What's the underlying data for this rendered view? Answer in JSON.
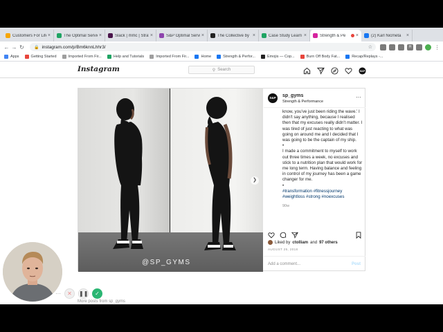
{
  "browser": {
    "tabs": [
      {
        "title": "Customers For Life",
        "color": "#f7a600",
        "active": false
      },
      {
        "title": "The Optimal Service",
        "color": "#1fa463",
        "active": false
      },
      {
        "title": "Slack | mmc | Strat",
        "color": "#4a154b",
        "active": false
      },
      {
        "title": "S&P Optimal Service",
        "color": "#8e44ad",
        "active": false
      },
      {
        "title": "The Collective by",
        "color": "#222222",
        "active": false
      },
      {
        "title": "Case Study Learn",
        "color": "#1fa463",
        "active": false
      },
      {
        "title": "Strength & Pe",
        "color": "#d6249f",
        "active": true
      },
      {
        "title": "(2) Karl Nicmeta",
        "color": "#1877f2",
        "active": false
      }
    ],
    "url": "instagram.com/p/Bm6knnLhhr3/",
    "bookmarks": [
      {
        "label": "Apps",
        "color": "#4285f4"
      },
      {
        "label": "Getting Started",
        "color": "#e8453c"
      },
      {
        "label": "Imported From Fir...",
        "color": "#9e9e9e"
      },
      {
        "label": "Help and Tutorials",
        "color": "#1fa463"
      },
      {
        "label": "Imported From Fir...",
        "color": "#9e9e9e"
      },
      {
        "label": "Home",
        "color": "#1877f2"
      },
      {
        "label": "Strength & Perfor...",
        "color": "#1877f2"
      },
      {
        "label": "Emojis — Cop...",
        "color": "#222222"
      },
      {
        "label": "Burn Off Body Fat...",
        "color": "#e8453c"
      },
      {
        "label": "Recap/Replays -...",
        "color": "#1877f2"
      }
    ],
    "extension_label": "H"
  },
  "instagram": {
    "logo": "Instagram",
    "search_placeholder": "Search",
    "post": {
      "username": "sp_gyms",
      "location": "Strength & Performance",
      "avatar_text": "S&P",
      "watermark": "@SP_GYMS",
      "caption_lines": [
        "know, you've just been riding the wave.' I didn't say anything, because I realised then that my excuses really didn't matter. I was tired of just reacting to what was going on around me and I decided that I was going to be the captain of my ship.",
        "•",
        "I made a commitment to myself to work out three times a week, no excuses and stick to a nutrition plan that would work for me long term. Having balance and feeling in control of my journey has been a game changer for me.",
        "•"
      ],
      "hashtags": "#transformation #fitnessjourney #weightloss #strong #noexcuses",
      "age": "90w",
      "liked_by_prefix": "Liked by",
      "liked_by_user": "ctolliam",
      "liked_by_and": "and",
      "liked_by_count": "97 others",
      "date": "AUGUST 25, 2018",
      "comment_placeholder": "Add a comment...",
      "post_button": "Post"
    },
    "more_posts": "More posts from sp_gyms"
  },
  "recorder": {
    "more": "···"
  }
}
